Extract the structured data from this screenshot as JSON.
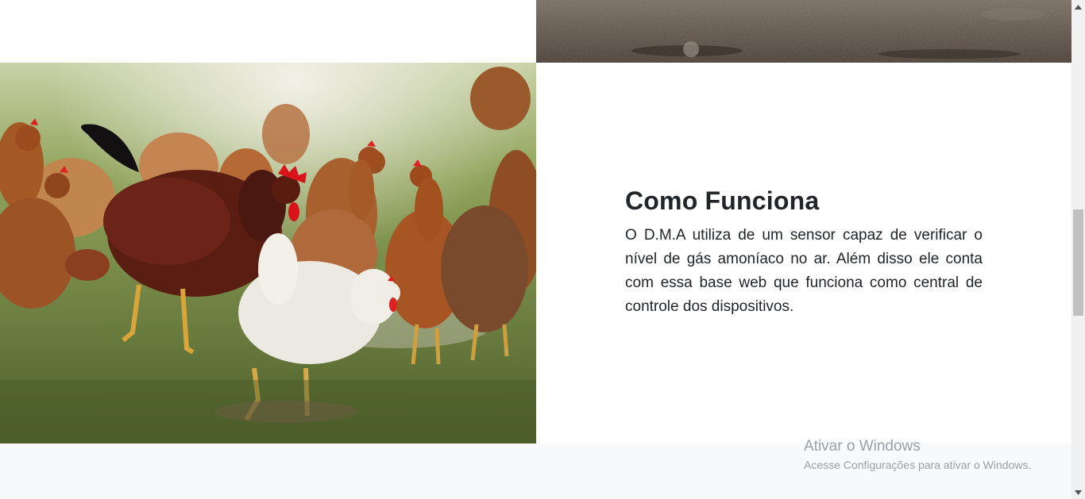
{
  "section": {
    "title": "Como Funciona",
    "body": "O D.M.A utiliza de um sensor capaz de verificar o nível de gás amoníaco no ar. Além disso ele conta com essa base web que funciona como central de controle dos dispositivos."
  },
  "images": {
    "top_right": "soil-ground-photo",
    "left": "chickens-in-grass-photo"
  },
  "watermark": {
    "title": "Ativar o Windows",
    "subtitle": "Acesse Configurações para ativar o Windows."
  },
  "colors": {
    "text": "#212529",
    "footer_bg": "#f8f9fa",
    "watermark": "#9aa0a6"
  }
}
